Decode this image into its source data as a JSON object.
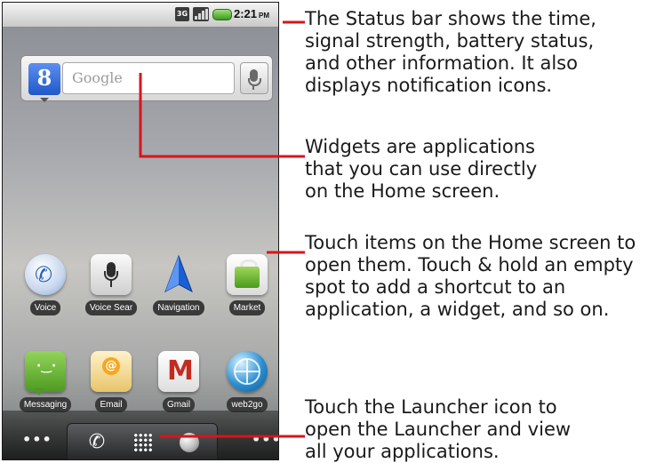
{
  "status_bar": {
    "net_icon": "data-network-icon",
    "signal_icon": "signal-strength-icon",
    "battery_icon": "battery-icon",
    "time": "2:21",
    "ampm": "PM"
  },
  "search_widget": {
    "logo_glyph": "8",
    "placeholder": "Google",
    "mic_icon": "microphone-icon"
  },
  "apps": {
    "voice": "Voice",
    "voice_search": "Voice Sear",
    "navigation": "Navigation",
    "market": "Market",
    "messaging": "Messaging",
    "email": "Email",
    "gmail": "Gmail",
    "web2go": "web2go"
  },
  "dock": {
    "left_ellipsis": "•••",
    "right_ellipsis": "•••",
    "phone_icon": "phone-icon",
    "launcher_icon": "launcher-grid-icon",
    "browser_icon": "browser-icon"
  },
  "captions": {
    "status_bar": "The Status bar shows the time,\nsignal strength, battery status,\nand other information. It also\ndisplays notification icons.",
    "widgets": "Widgets are applications\nthat you can use directly\non the Home screen.",
    "touch_items": "Touch items on the Home screen to\nopen them. Touch & hold an empty\nspot to add a shortcut to an\napplication, a widget, and so on.",
    "launcher": "Touch the Launcher icon to\nopen the Launcher and view\nall your applications."
  },
  "colors": {
    "callout_red": "#d9141b",
    "label_bg": "#3a3a3a"
  }
}
